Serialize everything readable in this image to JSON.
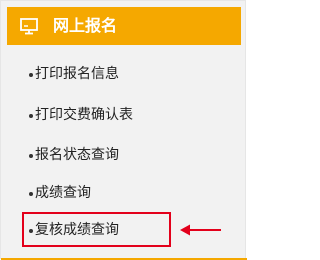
{
  "header": {
    "title": "网上报名",
    "icon": "monitor-icon",
    "background_color": "#f5a800"
  },
  "menu": {
    "items": [
      {
        "label": "打印报名信息"
      },
      {
        "label": "打印交费确认表"
      },
      {
        "label": "报名状态查询"
      },
      {
        "label": "成绩查询"
      },
      {
        "label": "复核成绩查询",
        "highlighted": true
      }
    ]
  },
  "annotation": {
    "highlight_color": "#e3001b",
    "arrow_icon": "left-arrow-icon"
  }
}
